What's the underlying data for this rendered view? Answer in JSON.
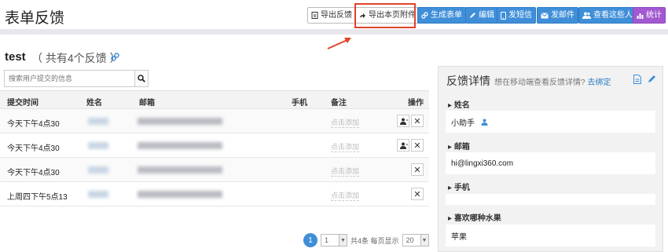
{
  "header": {
    "title": "表单反馈",
    "toolbar": {
      "export_feedback": "导出反馈",
      "export_attachments": "导出本页附件",
      "generate_form": "生成表单",
      "edit": "编辑",
      "send_sms": "发短信",
      "send_email": "发邮件",
      "view_people": "查看这些人",
      "stats": "统计"
    }
  },
  "form": {
    "name": "test",
    "count_text": "（ 共有4个反馈 ）"
  },
  "search": {
    "placeholder": "搜索用户提交的信息"
  },
  "table": {
    "headers": {
      "time": "提交时间",
      "name": "姓名",
      "email": "邮箱",
      "phone": "手机",
      "note": "备注",
      "actions": "操作"
    },
    "rows": [
      {
        "time": "今天下午4点30",
        "note": "点击添加"
      },
      {
        "time": "今天下午4点30",
        "note": "点击添加"
      },
      {
        "time": "今天下午4点30",
        "note": "点击添加"
      },
      {
        "time": "上周四下午5点13",
        "note": "点击添加"
      }
    ]
  },
  "pagination": {
    "current": "1",
    "page_select": "1",
    "summary": "共4条 每页显示",
    "page_size": "20"
  },
  "detail": {
    "title": "反馈详情",
    "subtitle": "想在移动端查看反馈详情?",
    "bind_link": "去绑定",
    "fields": [
      {
        "label": "姓名",
        "value": "小助手"
      },
      {
        "label": "邮箱",
        "value": "hi@lingxi360.com"
      },
      {
        "label": "手机",
        "value": ""
      },
      {
        "label": "喜欢哪种水果",
        "value": "苹果"
      }
    ]
  },
  "colors": {
    "primary": "#3f8ed8",
    "purple": "#a258d0",
    "highlight": "#e0432b"
  }
}
